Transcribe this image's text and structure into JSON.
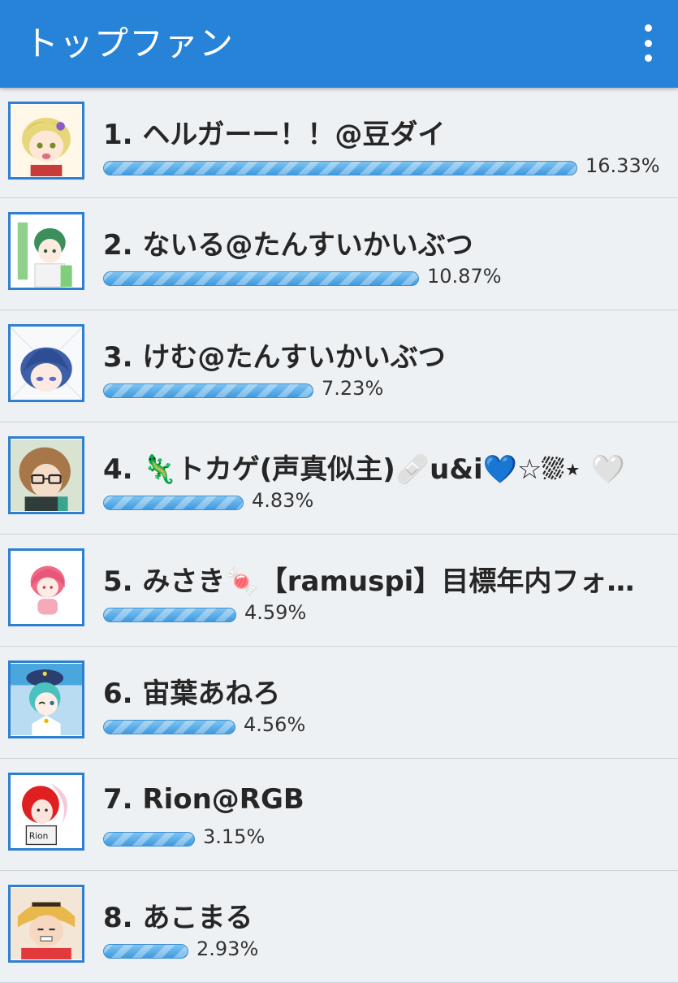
{
  "header": {
    "title": "トップファン",
    "menu_icon": "more-vert-icon"
  },
  "colors": {
    "header_bg": "#2683d8",
    "bar_start": "#7fc3f0",
    "bar_end": "#3f9ae0",
    "avatar_border": "#2f7fd1"
  },
  "fans": [
    {
      "label": "1. ヘルガーー！！@豆ダイ",
      "percent_label": "16.33%",
      "share": 16.33
    },
    {
      "label": "2. ないる@たんすいかいぶつ",
      "percent_label": "10.87%",
      "share": 10.87
    },
    {
      "label": "3. けむ@たんすいかいぶつ",
      "percent_label": "7.23%",
      "share": 7.23
    },
    {
      "label": "4. 🦎トカゲ(声真似主)🩹u&i💙☆⛆⋆ 🤍",
      "percent_label": "4.83%",
      "share": 4.83
    },
    {
      "label": "5. みさき🍬【ramuspi】目標年内フォ…",
      "percent_label": "4.59%",
      "share": 4.59
    },
    {
      "label": "6. 宙葉あねろ",
      "percent_label": "4.56%",
      "share": 4.56
    },
    {
      "label": "7. Rion@RGB",
      "percent_label": "3.15%",
      "share": 3.15
    },
    {
      "label": "8. あこまる",
      "percent_label": "2.93%",
      "share": 2.93
    }
  ]
}
